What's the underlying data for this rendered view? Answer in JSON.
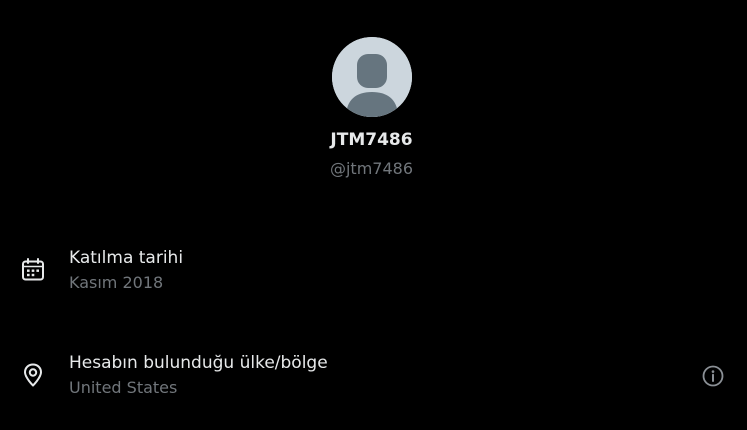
{
  "profile": {
    "display_name": "JTM7486",
    "handle": "@jtm7486",
    "avatar_icon": "default-avatar-icon"
  },
  "details": [
    {
      "icon": "calendar-icon",
      "label": "Katılma tarihi",
      "value": "Kasım 2018"
    },
    {
      "icon": "location-pin-icon",
      "label": "Hesabın bulunduğu ülke/bölge",
      "value": "United States",
      "action_icon": "info-icon"
    }
  ],
  "colors": {
    "background": "#000000",
    "primary_text": "#e7e9ea",
    "secondary_text": "#71767b",
    "avatar_bg": "#ccd6dd",
    "avatar_figure": "#66757f"
  }
}
